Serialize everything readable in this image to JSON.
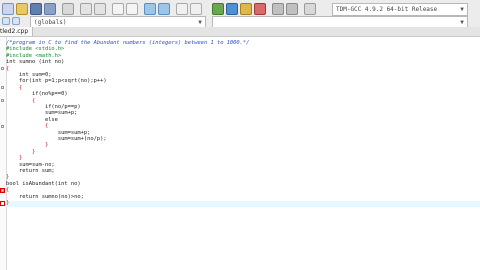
{
  "toolbar": {
    "compiler_select": "TDM-GCC 4.9.2 64-bit Release",
    "scope_select": "(globals)",
    "scope_select_2": ""
  },
  "tab": {
    "label": "tled2.cpp"
  },
  "code_lines": [
    {
      "text": "/*program in C to find the Abundant numbers (integers) between 1 to 1000.*/",
      "cls": "cm"
    },
    {
      "text": "#include <stdio.h>",
      "cls": "pp"
    },
    {
      "text": "#include <math.h>",
      "cls": "pp"
    },
    {
      "text": "int sumno (int no)",
      "cls": ""
    },
    {
      "text": "{",
      "cls": "op"
    },
    {
      "text": "    int sum=0;",
      "cls": ""
    },
    {
      "text": "    for(int p=1;p<sqrt(no);p++)",
      "cls": ""
    },
    {
      "text": "    {",
      "cls": "op"
    },
    {
      "text": "        if(no%p==0)",
      "cls": ""
    },
    {
      "text": "        {",
      "cls": "op"
    },
    {
      "text": "            if(no/p==p)",
      "cls": ""
    },
    {
      "text": "            sum=sum+p;",
      "cls": ""
    },
    {
      "text": "            else",
      "cls": ""
    },
    {
      "text": "            {",
      "cls": "op"
    },
    {
      "text": "                sum=sum+p;",
      "cls": ""
    },
    {
      "text": "                sum=sum+(no/p);",
      "cls": ""
    },
    {
      "text": "            }",
      "cls": "op"
    },
    {
      "text": "        }",
      "cls": "op"
    },
    {
      "text": "    }",
      "cls": "op"
    },
    {
      "text": "    sum=sum-no;",
      "cls": ""
    },
    {
      "text": "    return sum;",
      "cls": ""
    },
    {
      "text": "}",
      "cls": "op"
    },
    {
      "text": "bool isAbundant(int no)",
      "cls": ""
    },
    {
      "text": "{",
      "cls": "op"
    },
    {
      "text": "    return sumno(no)>no;",
      "cls": ""
    },
    {
      "text": "}",
      "cls": "op"
    }
  ],
  "colors": {
    "highlight_line": "#e6f8ff",
    "breakpoint": "#dd0000"
  }
}
